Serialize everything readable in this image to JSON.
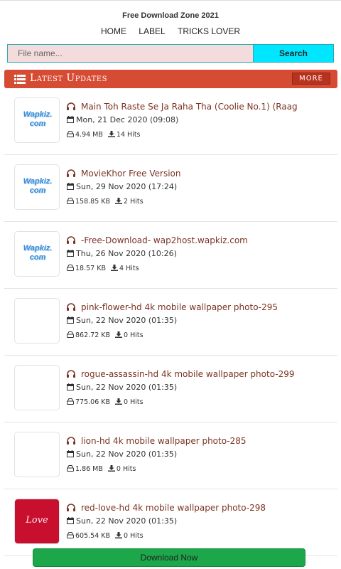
{
  "site": {
    "title": "Free Download Zone 2021"
  },
  "nav": {
    "items": [
      "HOME",
      "LABEL",
      "TRICKS LOVER"
    ]
  },
  "search": {
    "placeholder": "File name...",
    "button_label": "Search"
  },
  "section": {
    "title": "Latest Updates",
    "more_label": "MORE"
  },
  "thumb_text": {
    "wapkiz_line1": "Wapkiz.",
    "wapkiz_line2": "com",
    "love": "Love"
  },
  "items": [
    {
      "name": "Main Toh Raste Se Ja Raha Tha (Coolie No.1) (Raag",
      "date": "Mon, 21 Dec 2020 (09:08)",
      "size": "4.94 MB",
      "hits": "14 Hits",
      "thumb": "wapkiz"
    },
    {
      "name": "MovieKhor Free Version",
      "date": "Sun, 29 Nov 2020 (17:24)",
      "size": "158.85 KB",
      "hits": "2 Hits",
      "thumb": "wapkiz"
    },
    {
      "name": "-Free-Download- wap2host.wapkiz.com",
      "date": "Thu, 26 Nov 2020 (10:26)",
      "size": "18.57 KB",
      "hits": "4 Hits",
      "thumb": "wapkiz"
    },
    {
      "name": "pink-flower-hd 4k mobile wallpaper photo-295",
      "date": "Sun, 22 Nov 2020 (01:35)",
      "size": "862.72 KB",
      "hits": "0 Hits",
      "thumb": "blank"
    },
    {
      "name": "rogue-assassin-hd 4k mobile wallpaper photo-299",
      "date": "Sun, 22 Nov 2020 (01:35)",
      "size": "775.06 KB",
      "hits": "0 Hits",
      "thumb": "blank"
    },
    {
      "name": "lion-hd 4k mobile wallpaper photo-285",
      "date": "Sun, 22 Nov 2020 (01:35)",
      "size": "1.86 MB",
      "hits": "0 Hits",
      "thumb": "blank"
    },
    {
      "name": "red-love-hd 4k mobile wallpaper photo-298",
      "date": "Sun, 22 Nov 2020 (01:35)",
      "size": "605.54 KB",
      "hits": "0 Hits",
      "thumb": "love"
    }
  ],
  "download": {
    "label": "Download Now"
  },
  "colors": {
    "accent": "#d64b33",
    "search_button": "#00e6ff",
    "download": "#1ca84a",
    "link": "#7a3322"
  }
}
